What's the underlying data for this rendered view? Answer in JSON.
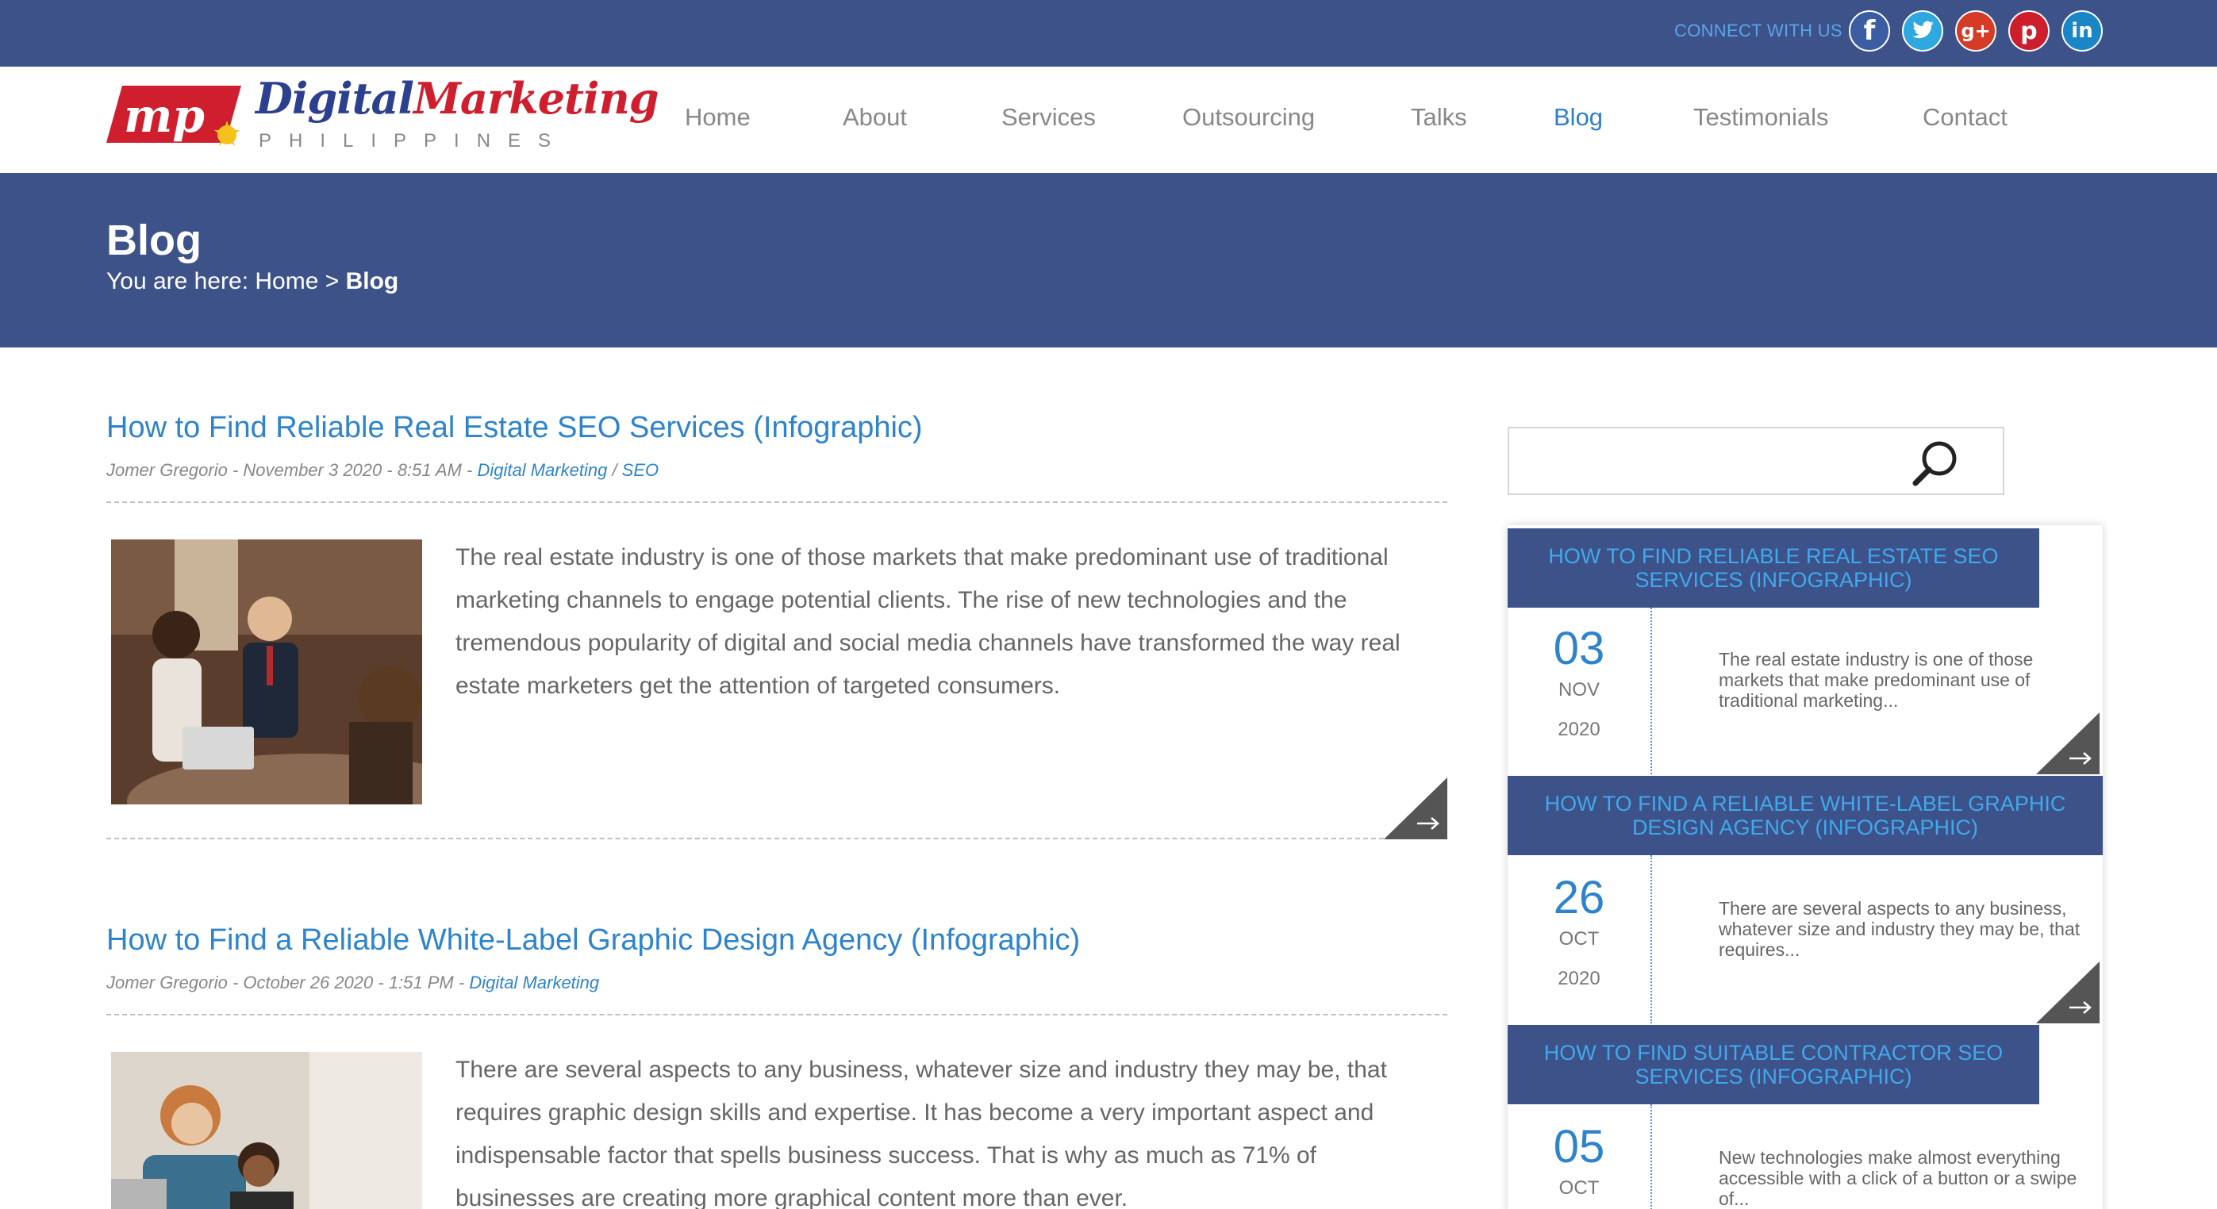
{
  "topbar": {
    "connect_label": "CONNECT WITH US",
    "social": [
      {
        "name": "facebook-icon",
        "glyph": "f"
      },
      {
        "name": "twitter-icon",
        "glyph": "t"
      },
      {
        "name": "google-plus-icon",
        "glyph": "g+"
      },
      {
        "name": "pinterest-icon",
        "glyph": "p"
      },
      {
        "name": "linkedin-icon",
        "glyph": "in"
      }
    ]
  },
  "logo": {
    "title_part1": "Digital",
    "title_part2": "Marketing",
    "subtitle": "PHILIPPINES"
  },
  "nav": {
    "items": [
      "Home",
      "About",
      "Services",
      "Outsourcing",
      "Talks",
      "Blog",
      "Testimonials",
      "Contact"
    ],
    "active": "Blog"
  },
  "banner": {
    "title": "Blog",
    "breadcrumb_prefix": "You are here: Home > ",
    "breadcrumb_current": "Blog"
  },
  "posts": [
    {
      "title": "How to Find Reliable Real Estate SEO Services (Infographic)",
      "meta": "Jomer Gregorio - November 3 2020 - 8:51 AM - ",
      "cat1": "Digital Marketing",
      "sep": " / ",
      "cat2": "SEO",
      "excerpt": "The real estate industry is one of those markets that make predominant use of traditional marketing channels to engage potential clients. The rise of new technologies and the tremendous popularity of digital and social media channels have transformed the way real estate marketers get the attention of targeted consumers."
    },
    {
      "title": "How to Find a Reliable White-Label Graphic Design Agency (Infographic)",
      "meta": "Jomer Gregorio - October 26 2020 - 1:51 PM - ",
      "cat1": "Digital Marketing",
      "excerpt": "There are several aspects to any business, whatever size and industry they may be, that requires graphic design skills and expertise. It has become a very important aspect and indispensable factor that spells business success. That is why as much as 71% of businesses are creating more graphical content more than ever."
    }
  ],
  "sidebar": {
    "search": {
      "placeholder": ""
    },
    "recent": [
      {
        "title": "HOW TO FIND RELIABLE REAL ESTATE SEO SERVICES (INFOGRAPHIC)",
        "day": "03",
        "month": "NOV",
        "year": "2020",
        "excerpt": "The real estate industry is one of those markets that make predominant use of traditional marketing..."
      },
      {
        "title": "HOW TO FIND A RELIABLE WHITE-LABEL GRAPHIC DESIGN AGENCY (INFOGRAPHIC)",
        "day": "26",
        "month": "OCT",
        "year": "2020",
        "excerpt": "There are several aspects to any business, whatever size and industry they may be, that requires..."
      },
      {
        "title": "HOW TO FIND SUITABLE CONTRACTOR SEO SERVICES (INFOGRAPHIC)",
        "day": "05",
        "month": "OCT",
        "year": "",
        "excerpt": "New technologies make almost everything accessible with a click of a button or a swipe of..."
      }
    ]
  },
  "colors": {
    "brand_blue": "#3d5289",
    "link_blue": "#2e84cc",
    "logo_red": "#cf1f2e"
  }
}
